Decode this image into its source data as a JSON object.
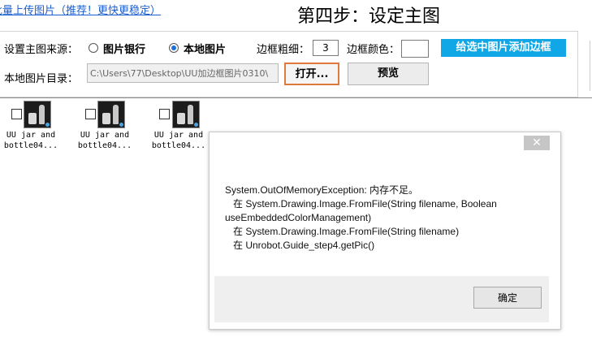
{
  "header": {
    "top_link": "批量上传图片（推荐！更快更稳定）",
    "step_title": "第四步：设定主图"
  },
  "settings": {
    "source_label": "设置主图来源：",
    "source_options": [
      {
        "label": "图片银行",
        "selected": false
      },
      {
        "label": "本地图片",
        "selected": true
      }
    ],
    "border_width_label": "边框粗细：",
    "border_width_value": "3",
    "border_color_label": "边框颜色：",
    "add_border_button": "给选中图片添加边框",
    "local_dir_label": "本地图片目录：",
    "local_dir_value": "C:\\Users\\77\\Desktop\\UU加边框图片0310\\",
    "open_button": "打开...",
    "preview_button": "预览"
  },
  "thumbnails": [
    {
      "caption_line1": "UU jar and",
      "caption_line2": "bottle04...",
      "checked": false
    },
    {
      "caption_line1": "UU jar and",
      "caption_line2": "bottle04...",
      "checked": false
    },
    {
      "caption_line1": "UU jar and",
      "caption_line2": "bottle04...",
      "checked": false
    }
  ],
  "dialog": {
    "close_glyph": "✕",
    "message_lines": [
      "System.OutOfMemoryException: 内存不足。",
      "   在 System.Drawing.Image.FromFile(String filename, Boolean",
      "useEmbeddedColorManagement)",
      "   在 System.Drawing.Image.FromFile(String filename)",
      "   在 Unrobot.Guide_step4.getPic()"
    ],
    "ok_button": "确定"
  },
  "colors": {
    "accent_button": "#11a6e5",
    "link": "#1a5fd0",
    "open_button_border": "#e07a3a"
  }
}
